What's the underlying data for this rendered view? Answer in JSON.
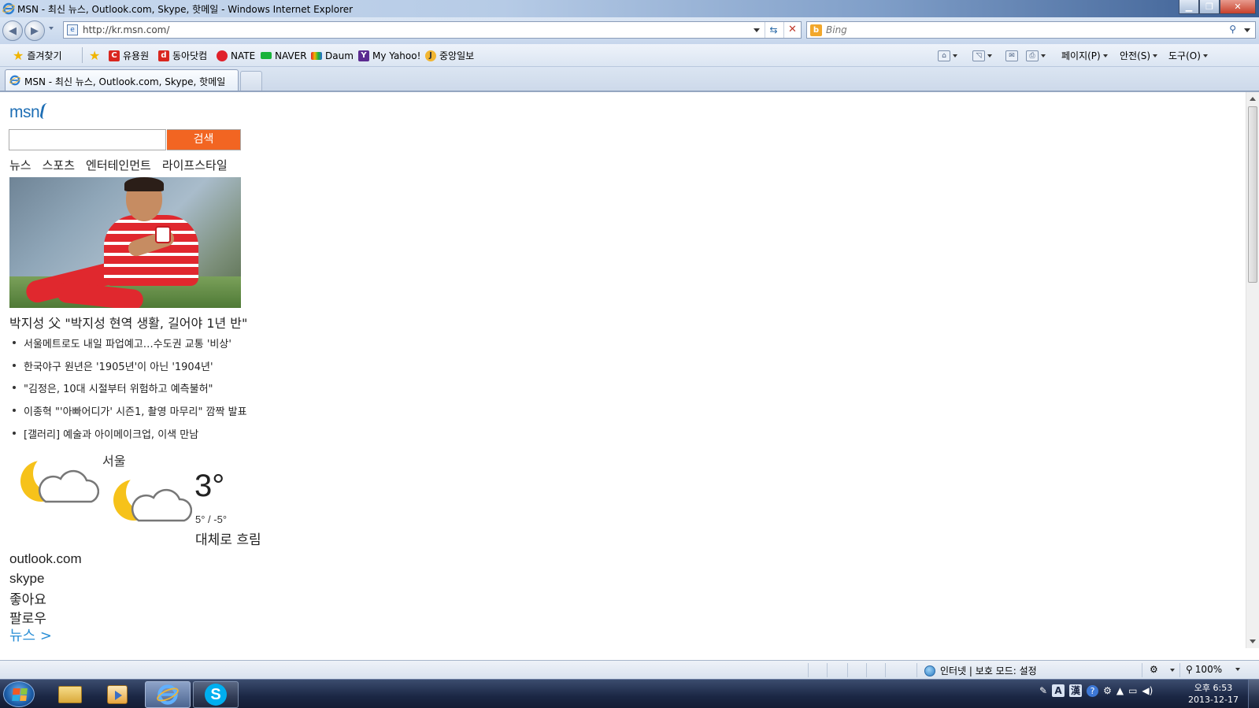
{
  "window": {
    "title": "MSN - 최신 뉴스, Outlook.com, Skype, 핫메일 - Windows Internet Explorer",
    "minimize_label": "▁",
    "maximize_label": "❐",
    "close_label": "✕"
  },
  "address_bar": {
    "url": "http://kr.msn.com/"
  },
  "search_bar": {
    "placeholder": "Bing"
  },
  "favorites_bar": {
    "favorites_label": "즐겨찾기",
    "links": [
      {
        "label": "유용원",
        "icon": "c-icon",
        "color": "#d9271f"
      },
      {
        "label": "동아닷컴",
        "icon": "d-icon",
        "color": "#d9271f"
      },
      {
        "label": "NATE",
        "icon": "nate-icon",
        "color": "#e0202a"
      },
      {
        "label": "NAVER",
        "icon": "naver-icon",
        "color": "#19b33b"
      },
      {
        "label": "Daum",
        "icon": "daum-icon",
        "color": "#f4b400"
      },
      {
        "label": "My Yahoo!",
        "icon": "yahoo-icon",
        "color": "#5c2b91"
      },
      {
        "label": "중앙일보",
        "icon": "joongang-icon",
        "color": "#f2b632"
      }
    ],
    "commands": {
      "page": "페이지(P)",
      "safety": "안전(S)",
      "tools": "도구(O)"
    }
  },
  "tab": {
    "label": "MSN - 최신 뉴스, Outlook.com, Skype, 핫메일"
  },
  "page": {
    "logo": "msn",
    "search_button": "검색",
    "nav": [
      "뉴스",
      "스포츠",
      "엔터테인먼트",
      "라이프스타일"
    ],
    "headline": "박지성 父 \"박지성 현역 생활, 길어야 1년 반\"",
    "bullets": [
      "서울메트로도 내일 파업예고…수도권 교통 '비상'",
      "한국야구 원년은 '1905년'이 아닌 '1904년'",
      "\"김정은, 10대 시절부터 위험하고 예측불허\"",
      "이종혁 \"'아빠어디가' 시즌1, 촬영 마무리\" 깜짝 발표",
      "[갤러리] 예술과 아이메이크업, 이색 만남"
    ],
    "weather": {
      "city": "서울",
      "temp": "3°",
      "hilo": "5° / -5°",
      "condition": "대체로 흐림"
    },
    "links": {
      "outlook": "outlook.com",
      "skype": "skype",
      "like": "좋아요",
      "follow": "팔로우",
      "news": "뉴스 >"
    }
  },
  "status_bar": {
    "zone": "인터넷 | 보호 모드: 설정",
    "zoom": "100%"
  },
  "taskbar": {
    "tray_lang": "A",
    "tray_hanja": "漢",
    "time": "오후 6:53",
    "date": "2013-12-17"
  },
  "colors": {
    "msn_blue": "#1f6fb5",
    "search_orange": "#f26522",
    "news_link": "#2b8fd6"
  }
}
